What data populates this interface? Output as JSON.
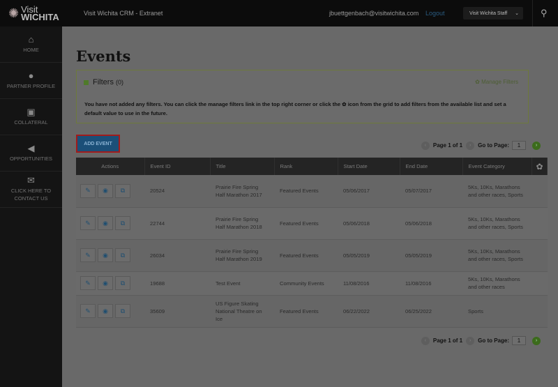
{
  "header": {
    "logo_top": "Visit",
    "logo_bottom": "WICHITA",
    "app_title": "Visit Wichita CRM - Extranet",
    "user_email": "jbuettgenbach@visitwichita.com",
    "logout": "Logout",
    "role_select": "Visit Wichita Staff"
  },
  "sidebar": {
    "items": [
      {
        "label": "HOME",
        "icon": "home-icon"
      },
      {
        "label": "PARTNER PROFILE",
        "icon": "user-icon"
      },
      {
        "label": "COLLATERAL",
        "icon": "image-file-icon"
      },
      {
        "label": "OPPORTUNITIES",
        "icon": "megaphone-icon"
      },
      {
        "label": "CLICK HERE TO CONTACT US",
        "icon": "envelope-icon"
      }
    ]
  },
  "page": {
    "title": "Events"
  },
  "filters": {
    "title": "Filters",
    "count": "(0)",
    "manage": "Manage Filters",
    "message": "You have not added any filters. You can click the manage filters link in the top right corner or click the ✿ icon from the grid to add filters from the available list and set a default value to use in the future."
  },
  "add_event": "ADD EVENT",
  "pager": {
    "page_text": "Page 1 of 1",
    "goto_label": "Go to Page:",
    "page_value": "1"
  },
  "table": {
    "columns": [
      "Actions",
      "Event ID",
      "Title",
      "Rank",
      "Start Date",
      "End Date",
      "Event Category"
    ],
    "rows": [
      {
        "id": "20524",
        "title": "Prairie Fire Spring Half Marathon 2017",
        "rank": "Featured Events",
        "start": "05/06/2017",
        "end": "05/07/2017",
        "category": "5Ks, 10Ks, Marathons and other races, Sports"
      },
      {
        "id": "22744",
        "title": "Prairie Fire Spring Half Marathon 2018",
        "rank": "Featured Events",
        "start": "05/06/2018",
        "end": "05/06/2018",
        "category": "5Ks, 10Ks, Marathons and other races, Sports"
      },
      {
        "id": "26034",
        "title": "Prairie Fire Spring Half Marathon 2019",
        "rank": "Featured Events",
        "start": "05/05/2019",
        "end": "05/05/2019",
        "category": "5Ks, 10Ks, Marathons and other races, Sports"
      },
      {
        "id": "19688",
        "title": "Test Event",
        "rank": "Community Events",
        "start": "11/08/2016",
        "end": "11/08/2016",
        "category": "5Ks, 10Ks, Marathons and other races"
      },
      {
        "id": "35609",
        "title": "US Figure Skating National Theatre on Ice",
        "rank": "Featured Events",
        "start": "06/22/2022",
        "end": "06/25/2022",
        "category": "Sports"
      }
    ]
  }
}
